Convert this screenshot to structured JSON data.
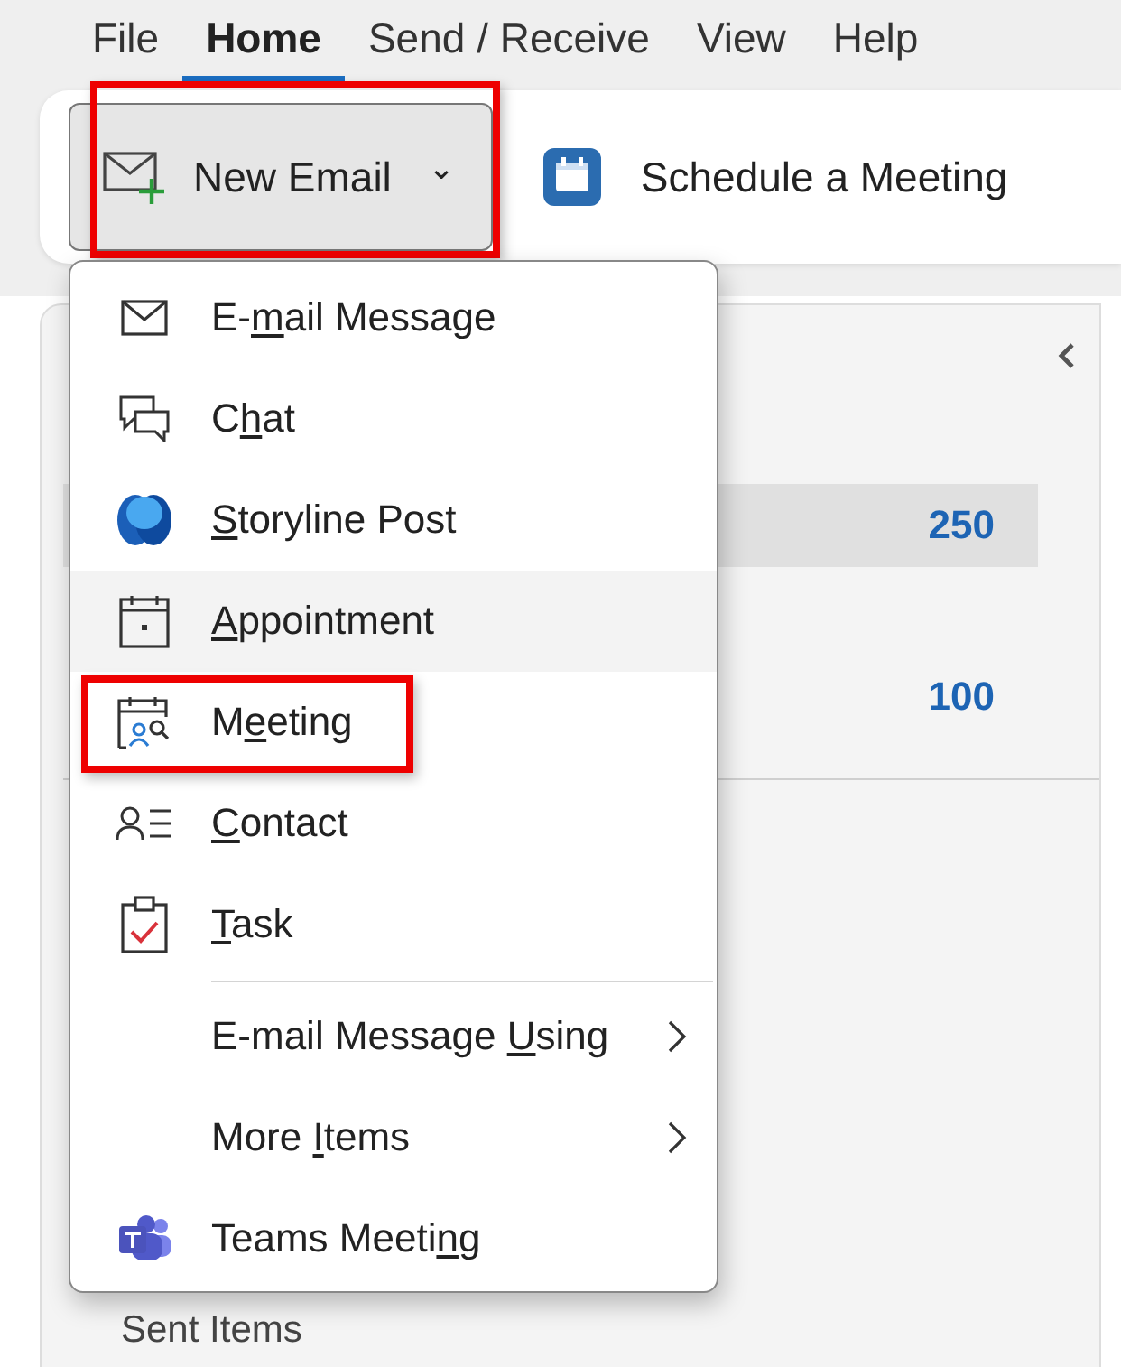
{
  "tabs": [
    {
      "label": "File",
      "selected": false
    },
    {
      "label": "Home",
      "selected": true
    },
    {
      "label": "Send / Receive",
      "selected": false
    },
    {
      "label": "View",
      "selected": false
    },
    {
      "label": "Help",
      "selected": false
    }
  ],
  "ribbon": {
    "new_email": {
      "label": "New Email",
      "caret": "⌄",
      "pressed": true,
      "outlined": true
    },
    "schedule": {
      "label": "Schedule a Meeting"
    }
  },
  "folder_pane": {
    "rows": [
      {
        "count": "250",
        "selected": true
      },
      {
        "count": "100",
        "selected": false
      }
    ],
    "footer_item": "Sent Items"
  },
  "menu": [
    {
      "kind": "mail",
      "label": {
        "pre": "E-",
        "key": "m",
        "post": "ail Message"
      },
      "hovered": false,
      "outlined": false,
      "submenu": false
    },
    {
      "kind": "chat",
      "label": {
        "pre": "C",
        "key": "h",
        "post": "at"
      },
      "hovered": false,
      "outlined": false,
      "submenu": false
    },
    {
      "kind": "storyline",
      "label": {
        "key": "S",
        "post": "toryline Post"
      },
      "hovered": false,
      "outlined": false,
      "submenu": false
    },
    {
      "kind": "appointment",
      "label": {
        "key": "A",
        "post": "ppointment"
      },
      "hovered": true,
      "outlined": false,
      "submenu": false
    },
    {
      "kind": "meeting",
      "label": {
        "pre": "M",
        "key": "e",
        "post": "eting"
      },
      "hovered": false,
      "outlined": true,
      "submenu": false
    },
    {
      "kind": "contact",
      "label": {
        "key": "C",
        "post": "ontact"
      },
      "hovered": false,
      "outlined": false,
      "submenu": false
    },
    {
      "kind": "task",
      "label": {
        "key": "T",
        "post": "ask"
      },
      "hovered": false,
      "outlined": false,
      "submenu": false
    },
    {
      "kind": "separator"
    },
    {
      "kind": "plain",
      "label": {
        "pre": "E-mail Message ",
        "key": "U",
        "post": "sing"
      },
      "hovered": false,
      "outlined": false,
      "submenu": true
    },
    {
      "kind": "plain",
      "label": {
        "pre": "More ",
        "key": "I",
        "post": "tems"
      },
      "hovered": false,
      "outlined": false,
      "submenu": true
    },
    {
      "kind": "teams",
      "label": {
        "pre": "Teams Meeti",
        "key": "n",
        "post": "g"
      },
      "hovered": false,
      "outlined": false,
      "submenu": false
    }
  ]
}
